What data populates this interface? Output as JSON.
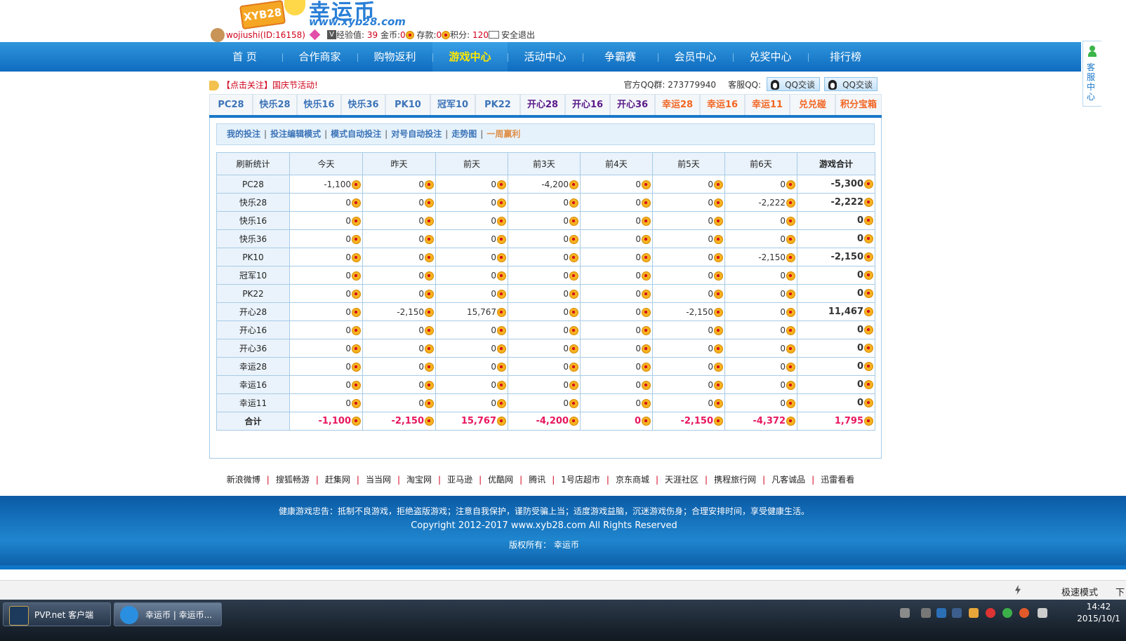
{
  "header": {
    "logo_badge": "XYB28",
    "logo_name": "幸运币",
    "logo_url": "www.xyb28.com",
    "user": {
      "name": "wojiushi(ID:16158)",
      "exp_label": "经验值:",
      "exp_value": "39",
      "gold_label": "金币:",
      "gold_value": "0",
      "deposit_label": "存款:",
      "deposit_value": "0",
      "points_label": "积分:",
      "points_value": "120",
      "logout": "安全退出"
    }
  },
  "nav": {
    "items": [
      "首 页",
      "合作商家",
      "购物返利",
      "游戏中心",
      "活动中心",
      "争霸赛",
      "会员中心",
      "兑奖中心",
      "排行榜"
    ],
    "active_index": 3
  },
  "sidebar": {
    "label": "客服中心"
  },
  "notice": {
    "text": "【点击关注】国庆节活动!",
    "qq_group_label": "官方QQ群:",
    "qq_group_value": "273779940",
    "kefu_label": "客服QQ:",
    "qq_btn_1": "QQ交谈",
    "qq_btn_2": "QQ交谈"
  },
  "game_tabs": [
    "PC28",
    "快乐28",
    "快乐16",
    "快乐36",
    "PK10",
    "冠军10",
    "PK22",
    "开心28",
    "开心16",
    "开心36",
    "幸运28",
    "幸运16",
    "幸运11",
    "兑兑碰",
    "积分宝箱"
  ],
  "subnav": [
    "我的投注",
    "投注编辑模式",
    "模式自动投注",
    "对号自动投注",
    "走势图",
    "一周赢利"
  ],
  "table": {
    "headers": [
      "刷新统计",
      "今天",
      "昨天",
      "前天",
      "前3天",
      "前4天",
      "前5天",
      "前6天",
      "游戏合计"
    ],
    "rows": [
      {
        "label": "PC28",
        "values": [
          "-1,100",
          "0",
          "0",
          "-4,200",
          "0",
          "0",
          "0",
          "-5,300"
        ]
      },
      {
        "label": "快乐28",
        "values": [
          "0",
          "0",
          "0",
          "0",
          "0",
          "0",
          "-2,222",
          "-2,222"
        ]
      },
      {
        "label": "快乐16",
        "values": [
          "0",
          "0",
          "0",
          "0",
          "0",
          "0",
          "0",
          "0"
        ]
      },
      {
        "label": "快乐36",
        "values": [
          "0",
          "0",
          "0",
          "0",
          "0",
          "0",
          "0",
          "0"
        ]
      },
      {
        "label": "PK10",
        "values": [
          "0",
          "0",
          "0",
          "0",
          "0",
          "0",
          "-2,150",
          "-2,150"
        ]
      },
      {
        "label": "冠军10",
        "values": [
          "0",
          "0",
          "0",
          "0",
          "0",
          "0",
          "0",
          "0"
        ]
      },
      {
        "label": "PK22",
        "values": [
          "0",
          "0",
          "0",
          "0",
          "0",
          "0",
          "0",
          "0"
        ]
      },
      {
        "label": "开心28",
        "values": [
          "0",
          "-2,150",
          "15,767",
          "0",
          "0",
          "-2,150",
          "0",
          "11,467"
        ]
      },
      {
        "label": "开心16",
        "values": [
          "0",
          "0",
          "0",
          "0",
          "0",
          "0",
          "0",
          "0"
        ]
      },
      {
        "label": "开心36",
        "values": [
          "0",
          "0",
          "0",
          "0",
          "0",
          "0",
          "0",
          "0"
        ]
      },
      {
        "label": "幸运28",
        "values": [
          "0",
          "0",
          "0",
          "0",
          "0",
          "0",
          "0",
          "0"
        ]
      },
      {
        "label": "幸运16",
        "values": [
          "0",
          "0",
          "0",
          "0",
          "0",
          "0",
          "0",
          "0"
        ]
      },
      {
        "label": "幸运11",
        "values": [
          "0",
          "0",
          "0",
          "0",
          "0",
          "0",
          "0",
          "0"
        ]
      }
    ],
    "total": {
      "label": "合计",
      "values": [
        "-1,100",
        "-2,150",
        "15,767",
        "-4,200",
        "0",
        "-2,150",
        "-4,372",
        "1,795"
      ]
    }
  },
  "links": [
    "新浪微博",
    "搜狐畅游",
    "赶集网",
    "当当网",
    "淘宝网",
    "亚马逊",
    "优酷网",
    "腾讯",
    "1号店超市",
    "京东商城",
    "天涯社区",
    "携程旅行网",
    "凡客诚品",
    "迅雷看看"
  ],
  "footer": {
    "warning": "健康游戏忠告：抵制不良游戏，拒绝盗版游戏；注意自我保护，谨防受骗上当；适度游戏益脑，沉迷游戏伤身；合理安排时间，享受健康生活。",
    "copyright": "Copyright 2012-2017  www.xyb28.com All Rights Reserved",
    "owner": "版权所有：  幸运币"
  },
  "statusbar": {
    "mode": "极速模式",
    "download": "下"
  },
  "taskbar": {
    "task1": "PVP.net 客户端",
    "task2": "幸运币 | 幸运币...",
    "time": "14:42",
    "date": "2015/10/1"
  }
}
